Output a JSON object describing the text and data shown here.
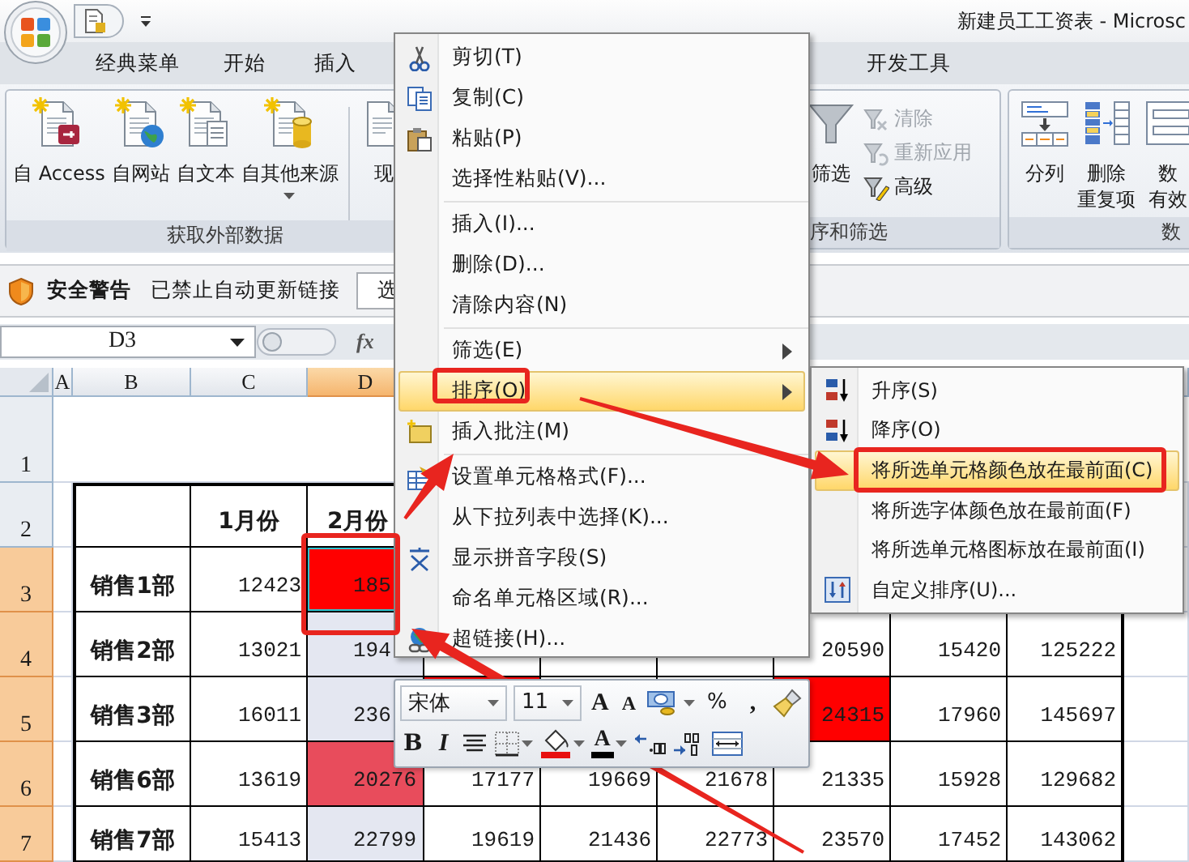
{
  "window": {
    "title": "新建员工工资表 - Microsc"
  },
  "ribbon_tabs": [
    {
      "label": "经典菜单"
    },
    {
      "label": "开始"
    },
    {
      "label": "插入"
    },
    {
      "label": "开发工具"
    }
  ],
  "ribbon_groups": [
    {
      "label": "获取外部数据",
      "buttons": [
        {
          "kind": "large",
          "lines": [
            "自 Access"
          ],
          "dropdown": false
        },
        {
          "kind": "large",
          "lines": [
            "自网站"
          ],
          "dropdown": false
        },
        {
          "kind": "large",
          "lines": [
            "自文本"
          ],
          "dropdown": false
        },
        {
          "kind": "large",
          "lines": [
            "自其他来源"
          ],
          "dropdown": true
        },
        {
          "kind": "large",
          "lines": [
            "现"
          ],
          "dropdown": false
        }
      ]
    },
    {
      "label": "序和筛选",
      "buttons": [
        {
          "kind": "large",
          "lines": [
            "筛选"
          ],
          "dropdown": false
        },
        {
          "kind": "small",
          "label": "清除",
          "disabled": true
        },
        {
          "kind": "small",
          "label": "重新应用",
          "disabled": true
        },
        {
          "kind": "small",
          "label": "高级",
          "disabled": false
        }
      ]
    },
    {
      "label": "数",
      "buttons": [
        {
          "kind": "large",
          "lines": [
            "分列"
          ],
          "dropdown": false
        },
        {
          "kind": "large",
          "lines": [
            "删除",
            "重复项"
          ],
          "dropdown": false
        },
        {
          "kind": "large",
          "lines": [
            "数",
            "有效"
          ],
          "dropdown": false
        }
      ]
    }
  ],
  "security_bar": {
    "title": "安全警告",
    "message": "已禁止自动更新链接",
    "button": "选"
  },
  "formula_bar": {
    "name_box": "D3",
    "fx": "fx"
  },
  "sheet": {
    "columns": [
      {
        "label": "A",
        "selected": false
      },
      {
        "label": "B",
        "selected": false
      },
      {
        "label": "C",
        "selected": false
      },
      {
        "label": "D",
        "selected": true
      }
    ],
    "rows": [
      {
        "label": "1",
        "selected": false,
        "kind": "blank"
      },
      {
        "label": "2",
        "selected": false,
        "kind": "header",
        "cells": [
          null,
          {
            "text": "1月份",
            "selected": false
          },
          {
            "text": "2月份",
            "selected": false
          },
          null,
          null,
          null,
          null,
          null,
          null
        ]
      },
      {
        "label": "3",
        "selected": true,
        "kind": "data",
        "cells": [
          {
            "text": "销售1部",
            "selected": false
          },
          {
            "text": "12423",
            "selected": false
          },
          {
            "text": "185",
            "active": true,
            "color": "#ff0000"
          },
          null,
          null,
          null,
          null,
          null,
          null
        ]
      },
      {
        "label": "4",
        "selected": true,
        "kind": "data",
        "cells": [
          {
            "text": "销售2部",
            "selected": false
          },
          {
            "text": "13021",
            "selected": false
          },
          {
            "text": "194",
            "selected": true
          },
          null,
          null,
          null,
          {
            "text": "20590",
            "selected": false
          },
          {
            "text": "15420",
            "selected": false
          },
          {
            "text": "125222",
            "selected": false
          }
        ]
      },
      {
        "label": "5",
        "selected": true,
        "kind": "data",
        "cells": [
          {
            "text": "销售3部",
            "selected": false
          },
          {
            "text": "16011",
            "selected": false
          },
          {
            "text": "236",
            "selected": true
          },
          {
            "color": "#ff0000"
          },
          null,
          null,
          {
            "text": "24315",
            "color": "#ff0000"
          },
          {
            "text": "17960",
            "selected": false
          },
          {
            "text": "145697",
            "selected": false
          }
        ]
      },
      {
        "label": "6",
        "selected": true,
        "kind": "data",
        "cells": [
          {
            "text": "销售6部",
            "selected": false
          },
          {
            "text": "13619",
            "selected": false
          },
          {
            "text": "20276",
            "color": "#e84c5c"
          },
          {
            "text": "17177",
            "selected": false
          },
          {
            "text": "19669",
            "selected": false
          },
          {
            "text": "21678",
            "selected": false
          },
          {
            "text": "21335",
            "selected": false
          },
          {
            "text": "15928",
            "selected": false
          },
          {
            "text": "129682",
            "selected": false
          }
        ]
      },
      {
        "label": "7",
        "selected": true,
        "kind": "data",
        "cells": [
          {
            "text": "销售7部",
            "selected": false
          },
          {
            "text": "15413",
            "selected": false
          },
          {
            "text": "22799",
            "selected": true
          },
          {
            "text": "19619",
            "selected": false
          },
          {
            "text": "21436",
            "selected": false
          },
          {
            "text": "22773",
            "selected": false
          },
          {
            "text": "23570",
            "selected": false
          },
          {
            "text": "17452",
            "selected": false
          },
          {
            "text": "143062",
            "selected": false
          }
        ]
      }
    ]
  },
  "context_menu": {
    "items": [
      {
        "kind": "item",
        "label": "剪切(T)",
        "highlighted": false
      },
      {
        "kind": "item",
        "label": "复制(C)",
        "highlighted": false
      },
      {
        "kind": "item",
        "label": "粘贴(P)",
        "highlighted": false
      },
      {
        "kind": "item",
        "label": "选择性粘贴(V)...",
        "highlighted": false
      },
      {
        "kind": "separator"
      },
      {
        "kind": "item",
        "label": "插入(I)...",
        "highlighted": false
      },
      {
        "kind": "item",
        "label": "删除(D)...",
        "highlighted": false
      },
      {
        "kind": "item",
        "label": "清除内容(N)",
        "highlighted": false
      },
      {
        "kind": "separator"
      },
      {
        "kind": "item",
        "label": "筛选(E)",
        "submenu": true,
        "highlighted": false
      },
      {
        "kind": "item",
        "label": "排序(O)",
        "submenu": true,
        "highlighted": true
      },
      {
        "kind": "item",
        "label": "插入批注(M)",
        "highlighted": false
      },
      {
        "kind": "separator"
      },
      {
        "kind": "item",
        "label": "设置单元格格式(F)...",
        "highlighted": false
      },
      {
        "kind": "item",
        "label": "从下拉列表中选择(K)...",
        "highlighted": false
      },
      {
        "kind": "item",
        "label": "显示拼音字段(S)",
        "highlighted": false
      },
      {
        "kind": "item",
        "label": "命名单元格区域(R)...",
        "highlighted": false
      },
      {
        "kind": "item",
        "label": "超链接(H)...",
        "highlighted": false
      }
    ]
  },
  "sort_submenu": {
    "items": [
      {
        "label": "升序(S)",
        "highlighted": false
      },
      {
        "label": "降序(O)",
        "highlighted": false
      },
      {
        "label": "将所选单元格颜色放在最前面(C)",
        "highlighted": true
      },
      {
        "label": "将所选字体颜色放在最前面(F)",
        "highlighted": false
      },
      {
        "label": "将所选单元格图标放在最前面(I)",
        "highlighted": false
      },
      {
        "label": "自定义排序(U)...",
        "highlighted": false
      }
    ]
  },
  "mini_toolbar": {
    "font": "宋体",
    "size": "11",
    "grow_font": "A",
    "shrink_font": "A",
    "percent": "%",
    "comma": ",",
    "bold": "B",
    "italic": "I",
    "font_color": "A"
  }
}
